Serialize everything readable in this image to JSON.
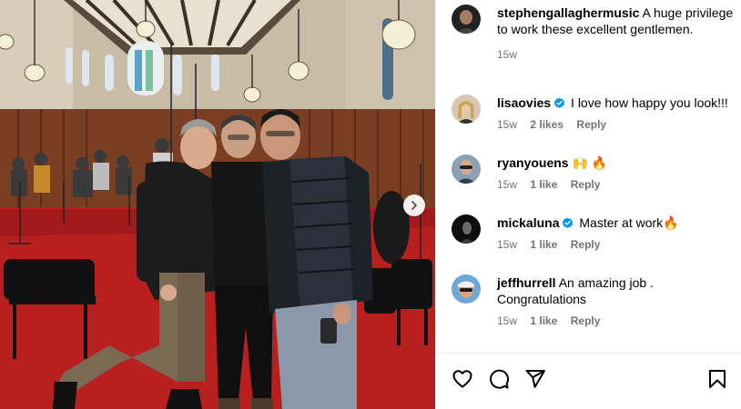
{
  "photo": {
    "alt_hint": ""
  },
  "post": {
    "caption": {
      "username": "stephengallaghermusic",
      "text": "A huge privilege to work these excellent gentlemen.",
      "time": "15w"
    },
    "comments": [
      {
        "username": "lisaovies",
        "verified": true,
        "text": "I love how happy you look!!!",
        "time": "15w",
        "likes": "2 likes",
        "reply": "Reply"
      },
      {
        "username": "ryanyouens",
        "verified": false,
        "text": "🙌 🔥",
        "time": "15w",
        "likes": "1 like",
        "reply": "Reply"
      },
      {
        "username": "mickaluna",
        "verified": true,
        "text": "Master at work🔥",
        "time": "15w",
        "likes": "1 like",
        "reply": "Reply"
      },
      {
        "username": "jeffhurrell",
        "verified": false,
        "text": "An amazing job . Congratulations",
        "time": "15w",
        "likes": "1 like",
        "reply": "Reply"
      }
    ]
  },
  "actions": {
    "like_icon": "heart-icon",
    "comment_icon": "comment-icon",
    "share_icon": "share-icon",
    "save_icon": "bookmark-icon"
  },
  "colors": {
    "verified": "#0095f6",
    "meta": "#737373",
    "carpet": "#b8201f"
  }
}
